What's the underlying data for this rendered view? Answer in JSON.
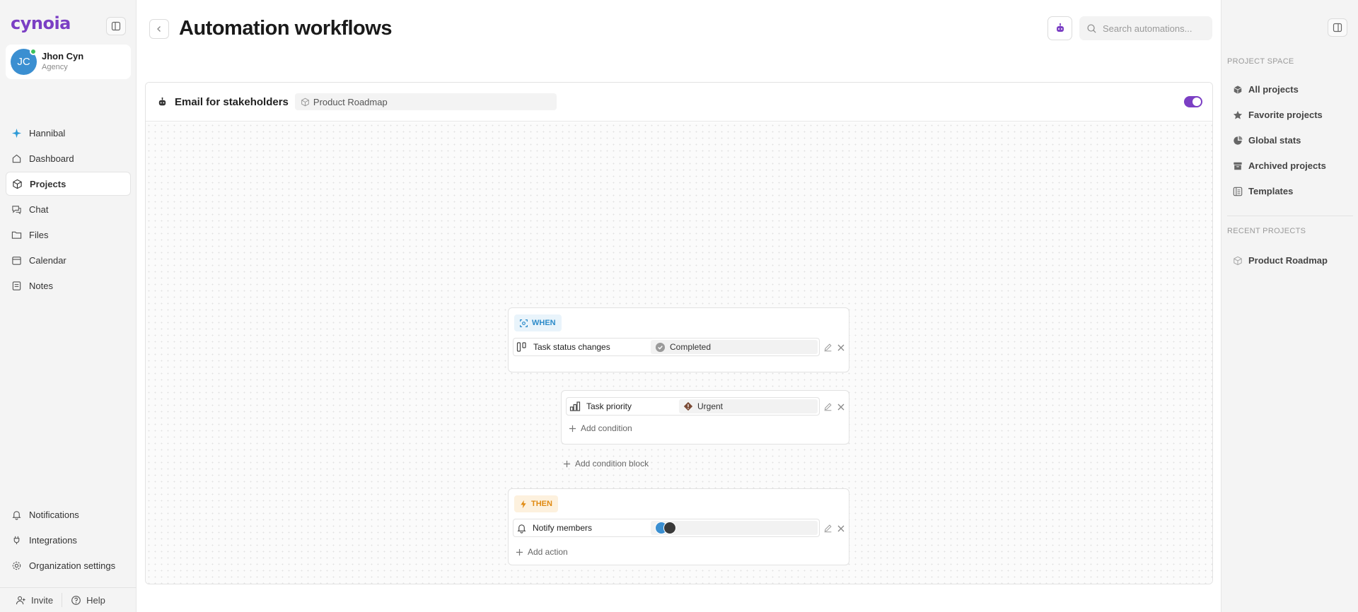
{
  "app": {
    "logo_text": "cynoia"
  },
  "user": {
    "initials": "JC",
    "name": "Jhon Cyn",
    "role": "Agency"
  },
  "nav": {
    "items": [
      {
        "label": "Hannibal",
        "icon": "sparkle-icon"
      },
      {
        "label": "Dashboard",
        "icon": "home-icon"
      },
      {
        "label": "Projects",
        "icon": "cube-icon",
        "active": true
      },
      {
        "label": "Chat",
        "icon": "chat-icon"
      },
      {
        "label": "Files",
        "icon": "folder-icon"
      },
      {
        "label": "Calendar",
        "icon": "calendar-icon"
      },
      {
        "label": "Notes",
        "icon": "note-icon"
      }
    ],
    "bottom_items": [
      {
        "label": "Notifications",
        "icon": "bell-icon"
      },
      {
        "label": "Integrations",
        "icon": "plug-icon"
      },
      {
        "label": "Organization settings",
        "icon": "gear-icon"
      }
    ],
    "invite_label": "Invite",
    "help_label": "Help"
  },
  "header": {
    "title": "Automation workflows",
    "search_placeholder": "Search automations..."
  },
  "workflow": {
    "name": "Email for stakeholders",
    "project": "Product Roadmap",
    "enabled": true,
    "when": {
      "badge": "WHEN",
      "trigger_label": "Task status changes",
      "trigger_value": "Completed"
    },
    "condition_block": {
      "condition_label": "Task priority",
      "condition_value": "Urgent",
      "add_condition": "Add condition"
    },
    "add_condition_block": "Add condition block",
    "then": {
      "badge": "THEN",
      "action_label": "Notify members",
      "add_action": "Add action"
    },
    "colors": {
      "accent": "#7b3fc4",
      "when": "#2d8bc9",
      "then": "#e08a12"
    }
  },
  "right_panel": {
    "project_space_title": "PROJECT SPACE",
    "items": [
      {
        "label": "All projects",
        "icon": "cube-icon"
      },
      {
        "label": "Favorite projects",
        "icon": "star-icon"
      },
      {
        "label": "Global stats",
        "icon": "pie-chart-icon"
      },
      {
        "label": "Archived projects",
        "icon": "archive-icon"
      },
      {
        "label": "Templates",
        "icon": "template-icon"
      }
    ],
    "recent_title": "RECENT PROJECTS",
    "recent": [
      {
        "label": "Product Roadmap",
        "icon": "cube-outline-icon"
      }
    ]
  }
}
